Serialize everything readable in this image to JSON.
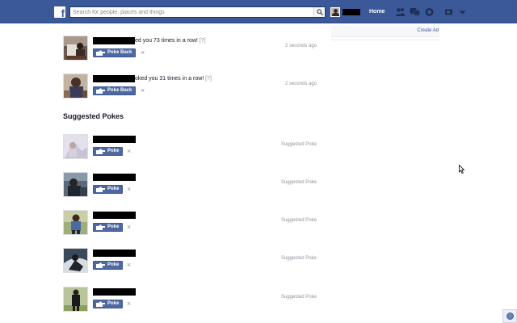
{
  "header": {
    "logo": "f",
    "search_placeholder": "Search for people, places and things",
    "home_label": "Home",
    "icons": [
      "friend-requests-icon",
      "messages-icon",
      "notifications-icon",
      "privacy-shortcuts-icon",
      "account-settings-icon"
    ],
    "colors": {
      "bar": "#3b5998",
      "text": "#ffffff"
    }
  },
  "pokes": [
    {
      "text": "ed you 73 times in a row!",
      "help": "[?]",
      "button": "Poke Back",
      "dismiss": "×",
      "time": "2 seconds ago"
    },
    {
      "text": "oked you 31 times in a row!",
      "help": "[?]",
      "button": "Poke Back",
      "dismiss": "×",
      "time": "2 seconds ago"
    }
  ],
  "suggested": {
    "title": "Suggested Pokes",
    "items": [
      {
        "button": "Poke",
        "dismiss": "×",
        "status": "Suggested Poke"
      },
      {
        "button": "Poke",
        "dismiss": "×",
        "status": "Suggested Poke"
      },
      {
        "button": "Poke",
        "dismiss": "×",
        "status": "Suggested Poke"
      },
      {
        "button": "Poke",
        "dismiss": "×",
        "status": "Suggested Poke"
      },
      {
        "button": "Poke",
        "dismiss": "×",
        "status": "Suggested Poke"
      }
    ]
  },
  "sidebar": {
    "create_ad": "Create Ad"
  }
}
